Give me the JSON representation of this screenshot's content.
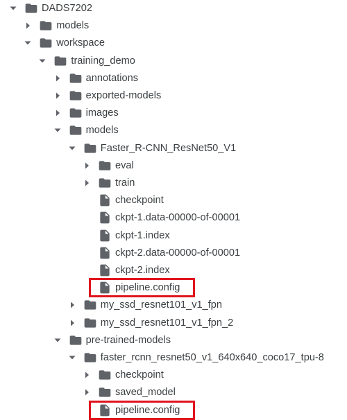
{
  "tree": {
    "items": [
      {
        "label": "DADS7202",
        "kind": "folder",
        "toggle": "expanded",
        "depth": 0
      },
      {
        "label": "models",
        "kind": "folder",
        "toggle": "collapsed",
        "depth": 1
      },
      {
        "label": "workspace",
        "kind": "folder",
        "toggle": "expanded",
        "depth": 1
      },
      {
        "label": "training_demo",
        "kind": "folder",
        "toggle": "expanded",
        "depth": 2
      },
      {
        "label": "annotations",
        "kind": "folder",
        "toggle": "collapsed",
        "depth": 3
      },
      {
        "label": "exported-models",
        "kind": "folder",
        "toggle": "collapsed",
        "depth": 3
      },
      {
        "label": "images",
        "kind": "folder",
        "toggle": "collapsed",
        "depth": 3
      },
      {
        "label": "models",
        "kind": "folder",
        "toggle": "expanded",
        "depth": 3
      },
      {
        "label": "Faster_R-CNN_ResNet50_V1",
        "kind": "folder",
        "toggle": "expanded",
        "depth": 4
      },
      {
        "label": "eval",
        "kind": "folder",
        "toggle": "collapsed",
        "depth": 5
      },
      {
        "label": "train",
        "kind": "folder",
        "toggle": "collapsed",
        "depth": 5
      },
      {
        "label": "checkpoint",
        "kind": "file",
        "toggle": "none",
        "depth": 5
      },
      {
        "label": "ckpt-1.data-00000-of-00001",
        "kind": "file",
        "toggle": "none",
        "depth": 5
      },
      {
        "label": "ckpt-1.index",
        "kind": "file",
        "toggle": "none",
        "depth": 5
      },
      {
        "label": "ckpt-2.data-00000-of-00001",
        "kind": "file",
        "toggle": "none",
        "depth": 5
      },
      {
        "label": "ckpt-2.index",
        "kind": "file",
        "toggle": "none",
        "depth": 5
      },
      {
        "label": "pipeline.config",
        "kind": "file",
        "toggle": "none",
        "depth": 5,
        "highlighted": true
      },
      {
        "label": "my_ssd_resnet101_v1_fpn",
        "kind": "folder",
        "toggle": "collapsed",
        "depth": 4
      },
      {
        "label": "my_ssd_resnet101_v1_fpn_2",
        "kind": "folder",
        "toggle": "collapsed",
        "depth": 4
      },
      {
        "label": "pre-trained-models",
        "kind": "folder",
        "toggle": "expanded",
        "depth": 3
      },
      {
        "label": "faster_rcnn_resnet50_v1_640x640_coco17_tpu-8",
        "kind": "folder",
        "toggle": "expanded",
        "depth": 4
      },
      {
        "label": "checkpoint",
        "kind": "folder",
        "toggle": "collapsed",
        "depth": 5
      },
      {
        "label": "saved_model",
        "kind": "folder",
        "toggle": "collapsed",
        "depth": 5
      },
      {
        "label": "pipeline.config",
        "kind": "file",
        "toggle": "none",
        "depth": 5,
        "highlighted": true
      }
    ]
  },
  "colors": {
    "icon": "#5f6368",
    "text": "#3c4043",
    "highlight": "#e0141e"
  },
  "icons": {
    "folder": "folder-icon",
    "file": "file-icon",
    "expanded": "caret-down-icon",
    "collapsed": "caret-right-icon"
  }
}
